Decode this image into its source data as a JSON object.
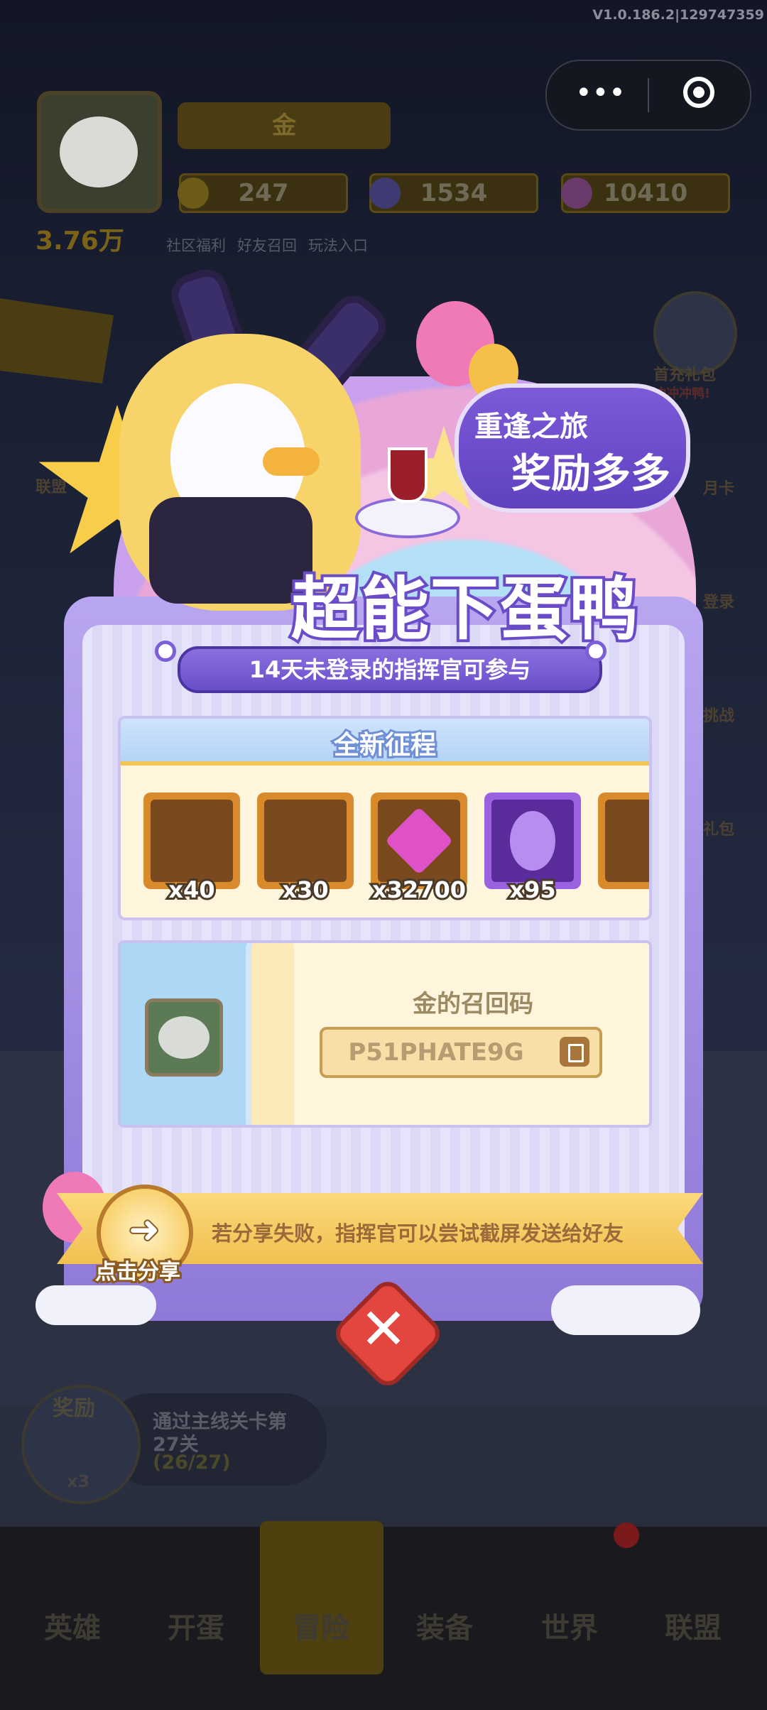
{
  "version": "V1.0.186.2|129747359",
  "player": {
    "name": "金",
    "power": "3.76万"
  },
  "resources": {
    "gold": "247",
    "gems": "1534",
    "crystal": "10410"
  },
  "top_links": [
    "社区福利",
    "好友召回",
    "玩法入口"
  ],
  "side_right": [
    "首充礼包",
    "冲冲冲鸭!",
    "月卡",
    "登录",
    "挑战",
    "礼包"
  ],
  "side_left": [
    "联盟"
  ],
  "popup": {
    "badge_line1": "重逢之旅",
    "badge_line2": "奖励多多",
    "title": "超能下蛋鸭",
    "subtitle": "14天未登录的指挥官可参与",
    "rewards_title": "全新征程",
    "rewards": [
      {
        "name": "hero-card-icon",
        "qty": "x40",
        "color": "#d98a2b"
      },
      {
        "name": "hero-card-icon-2",
        "qty": "x30",
        "color": "#d98a2b"
      },
      {
        "name": "gem-icon",
        "qty": "x32700",
        "color": "#e052c7"
      },
      {
        "name": "egg-icon",
        "qty": "x95",
        "color": "#9a62e0"
      }
    ],
    "code_label": "金的召回码",
    "code_value": "P51PHATE9G",
    "share_hint": "若分享失败，指挥官可以尝试截屏发送给好友",
    "share_button": "点击分享"
  },
  "quest": {
    "reward_label": "奖励",
    "reward_qty": "x3",
    "text_line1": "通过主线关卡第",
    "text_line2": "27关",
    "progress": "(26/27)"
  },
  "nav": [
    "英雄",
    "开蛋",
    "冒险",
    "装备",
    "世界",
    "联盟"
  ]
}
